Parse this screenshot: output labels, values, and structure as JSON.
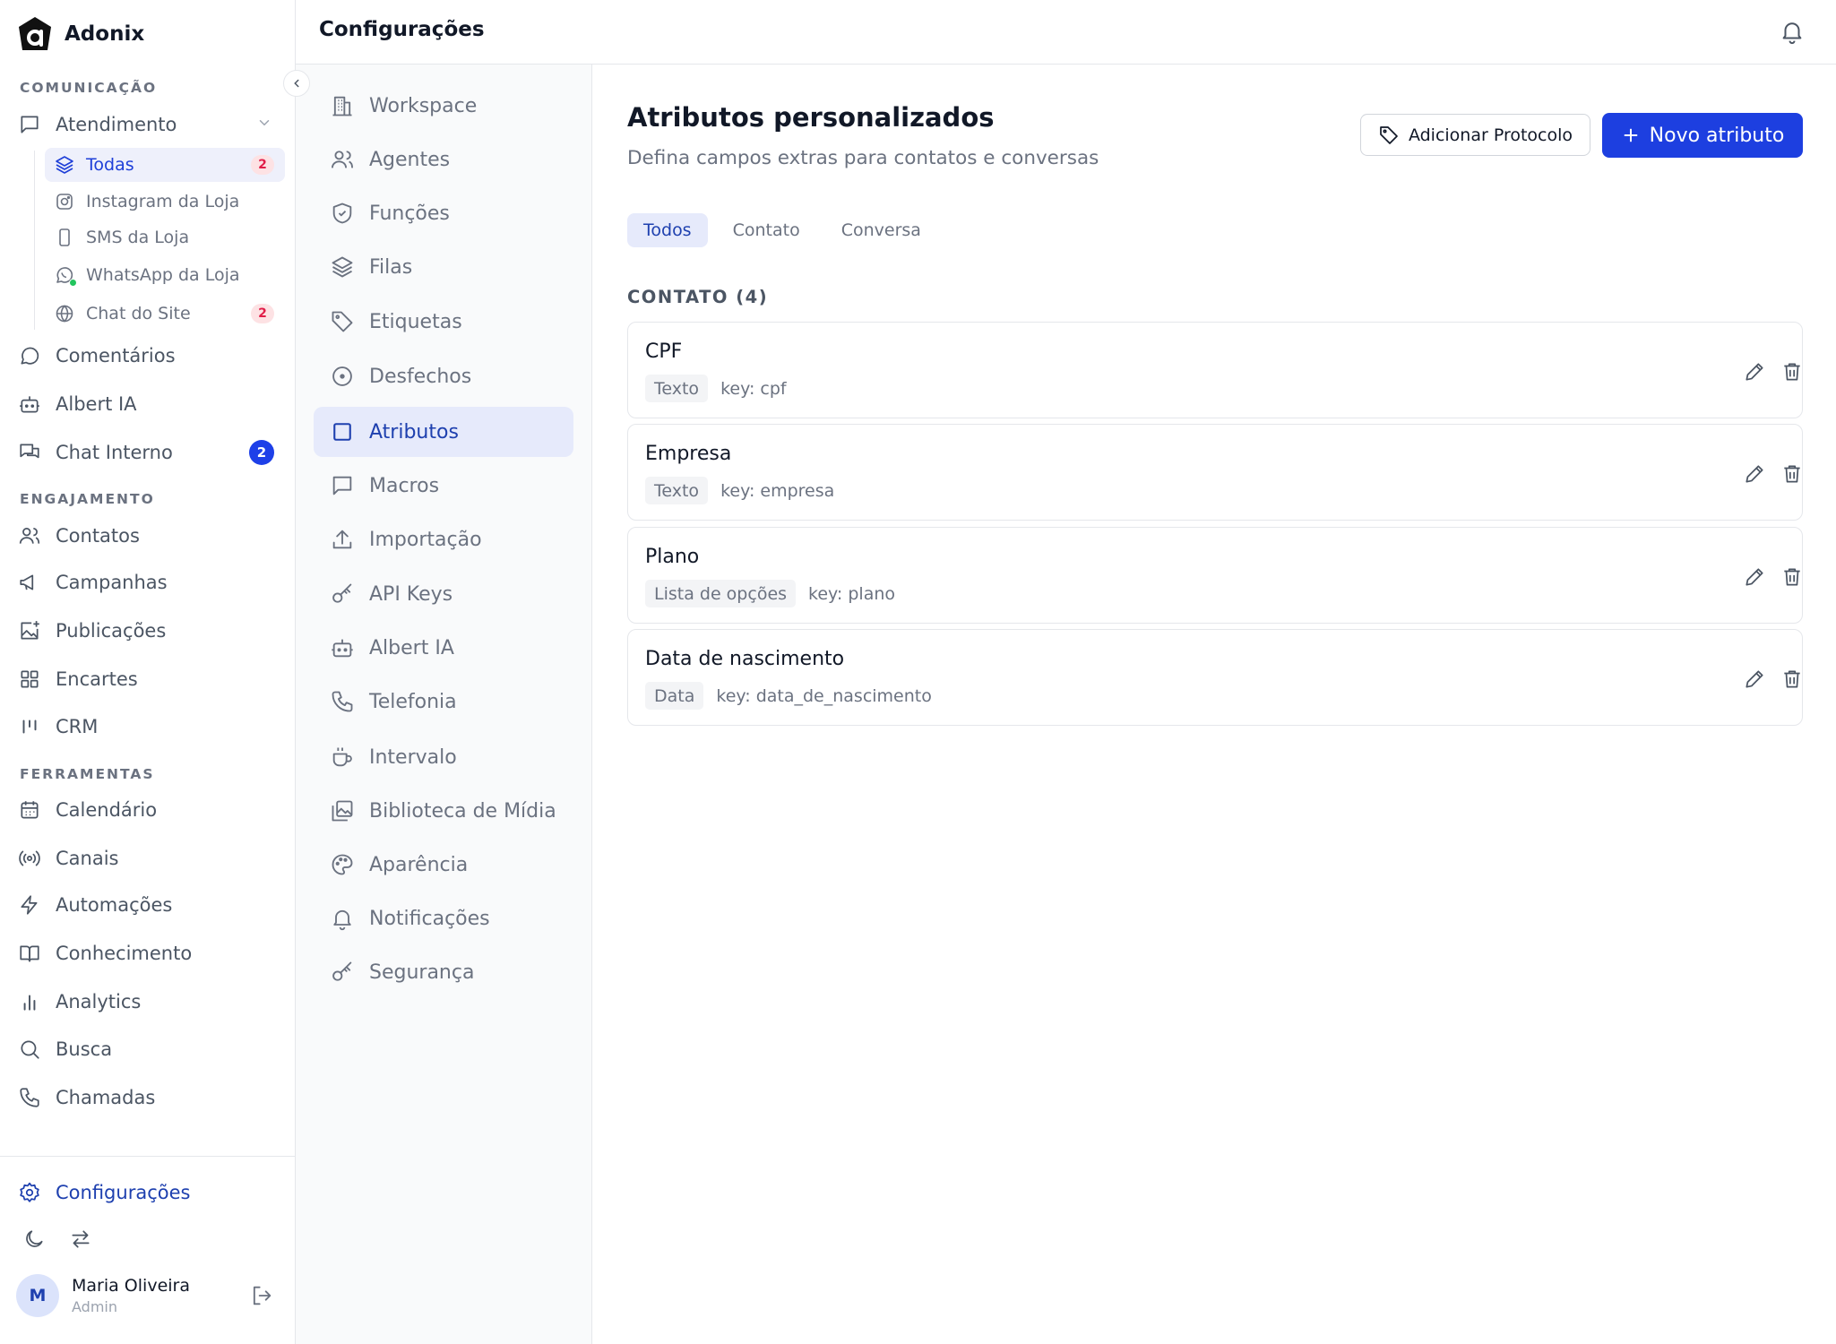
{
  "brand": {
    "name": "Adonix"
  },
  "sidebar": {
    "sections": {
      "comunicacao": "COMUNICAÇÃO",
      "engajamento": "ENGAJAMENTO",
      "ferramentas": "FERRAMENTAS"
    },
    "atendimento": {
      "label": "Atendimento",
      "children": [
        {
          "label": "Todas",
          "badge": "2",
          "active": true
        },
        {
          "label": "Instagram da Loja"
        },
        {
          "label": "SMS da Loja"
        },
        {
          "label": "WhatsApp da Loja"
        },
        {
          "label": "Chat do Site",
          "badge": "2"
        }
      ]
    },
    "comunicacao_items": [
      {
        "label": "Comentários"
      },
      {
        "label": "Albert IA"
      },
      {
        "label": "Chat Interno",
        "badge": "2"
      }
    ],
    "engajamento_items": [
      {
        "label": "Contatos"
      },
      {
        "label": "Campanhas"
      },
      {
        "label": "Publicações"
      },
      {
        "label": "Encartes"
      },
      {
        "label": "CRM"
      }
    ],
    "ferramentas_items": [
      {
        "label": "Calendário"
      },
      {
        "label": "Canais"
      },
      {
        "label": "Automações"
      },
      {
        "label": "Conhecimento"
      },
      {
        "label": "Analytics"
      },
      {
        "label": "Busca"
      },
      {
        "label": "Chamadas"
      }
    ],
    "settings_label": "Configurações",
    "user": {
      "initial": "M",
      "name": "Maria Oliveira",
      "role": "Admin"
    }
  },
  "header": {
    "title": "Configurações"
  },
  "settings_menu": [
    {
      "label": "Workspace",
      "icon": "building-icon"
    },
    {
      "label": "Agentes",
      "icon": "users-icon"
    },
    {
      "label": "Funções",
      "icon": "shield-icon"
    },
    {
      "label": "Filas",
      "icon": "layers-icon"
    },
    {
      "label": "Etiquetas",
      "icon": "tag-icon"
    },
    {
      "label": "Desfechos",
      "icon": "circle-dot-icon"
    },
    {
      "label": "Atributos",
      "icon": "square-icon",
      "active": true
    },
    {
      "label": "Macros",
      "icon": "message-icon"
    },
    {
      "label": "Importação",
      "icon": "upload-icon"
    },
    {
      "label": "API Keys",
      "icon": "key-icon"
    },
    {
      "label": "Albert IA",
      "icon": "bot-icon"
    },
    {
      "label": "Telefonia",
      "icon": "phone-icon"
    },
    {
      "label": "Intervalo",
      "icon": "coffee-icon"
    },
    {
      "label": "Biblioteca de Mídia",
      "icon": "images-icon"
    },
    {
      "label": "Aparência",
      "icon": "palette-icon"
    },
    {
      "label": "Notificações",
      "icon": "bell-icon"
    },
    {
      "label": "Segurança",
      "icon": "key-icon"
    }
  ],
  "main": {
    "title": "Atributos personalizados",
    "subtitle": "Defina campos extras para contatos e conversas",
    "add_protocol_label": "Adicionar Protocolo",
    "new_attribute_label": "Novo atributo",
    "tabs": [
      {
        "label": "Todos",
        "active": true
      },
      {
        "label": "Contato"
      },
      {
        "label": "Conversa"
      }
    ],
    "group_label": "CONTATO (4)",
    "attributes": [
      {
        "name": "CPF",
        "type": "Texto",
        "key": "key: cpf"
      },
      {
        "name": "Empresa",
        "type": "Texto",
        "key": "key: empresa"
      },
      {
        "name": "Plano",
        "type": "Lista de opções",
        "key": "key: plano"
      },
      {
        "name": "Data de nascimento",
        "type": "Data",
        "key": "key: data_de_nascimento"
      }
    ]
  },
  "colors": {
    "accent": "#1d3fe0",
    "active_bg": "#e6eafb",
    "badge_red_bg": "#fde2e4",
    "badge_red_text": "#e11d48"
  }
}
